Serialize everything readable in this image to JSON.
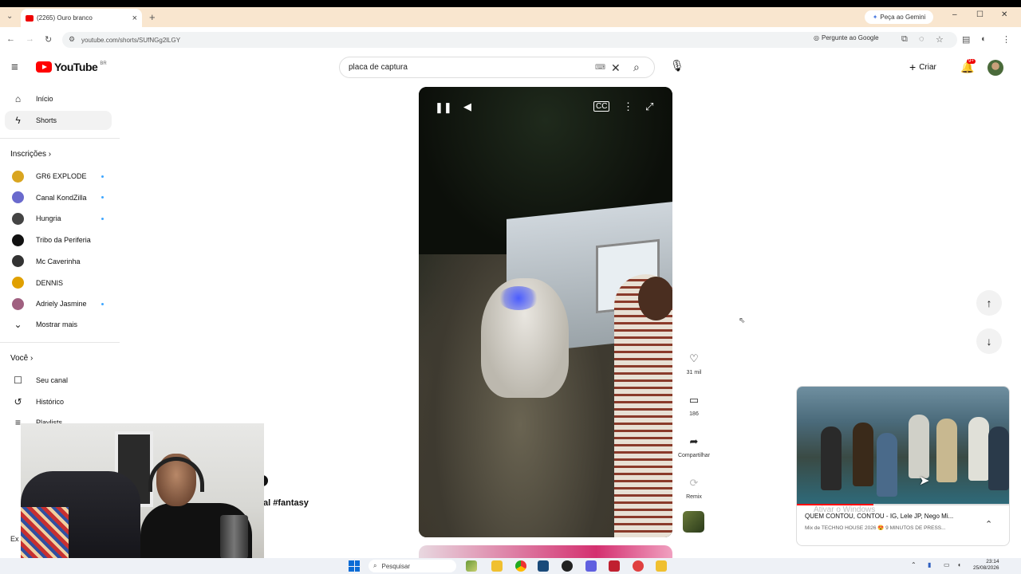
{
  "browser": {
    "tab_title": "(2265) Ouro branco",
    "new_tab": "+",
    "gemini_label": "Peça ao Gemini",
    "url": "youtube.com/shorts/SUfNGg2lLGY",
    "ask_google": "Pergunte ao Google"
  },
  "header": {
    "logo_text": "YouTube",
    "logo_region": "BR",
    "search_value": "placa de captura",
    "create_label": "Criar",
    "notification_count": "9+"
  },
  "sidebar": {
    "main": [
      {
        "label": "Início",
        "icon": "home-icon",
        "glyph": "⌂"
      },
      {
        "label": "Shorts",
        "icon": "shorts-icon",
        "glyph": "ϟ"
      }
    ],
    "subscriptions_title": "Inscrições",
    "subscriptions": [
      {
        "label": "GR6 EXPLODE",
        "color": "#d9a520",
        "new": true
      },
      {
        "label": "Canal KondZilla",
        "color": "#6a6acd",
        "new": true
      },
      {
        "label": "Hungria",
        "color": "#444444",
        "new": true
      },
      {
        "label": "Tribo da Periferia",
        "color": "#111111",
        "new": false
      },
      {
        "label": "Mc Caverinha",
        "color": "#333333",
        "new": false
      },
      {
        "label": "DENNIS",
        "color": "#e0a000",
        "new": false
      },
      {
        "label": "Adriely Jasmine",
        "color": "#a06080",
        "new": true
      }
    ],
    "show_more": "Mostrar mais",
    "you_title": "Você",
    "you_items": [
      {
        "label": "Seu canal",
        "glyph": "☐"
      },
      {
        "label": "Histórico",
        "glyph": "↺"
      },
      {
        "label": "Playlists",
        "glyph": "≡"
      }
    ],
    "explore_partial": "Ex"
  },
  "video": {
    "caption_partial": "al #fantasy"
  },
  "actions": {
    "likes": "31 mil",
    "comments": "186",
    "share": "Compartilhar",
    "remix": "Remix"
  },
  "miniplayer": {
    "title": "QUEM CONTOU, CONTOU - IG, Lele JP, Nego Mi...",
    "subtitle": "Mix de TECHNO HOUSE 2026 😍 9 MINUTOS DE PRESS...",
    "progress": 0.36
  },
  "windows_watermark": "Ativar o Windows",
  "taskbar": {
    "search_placeholder": "Pesquisar",
    "time": "23:14",
    "date": "25/08/2026"
  },
  "colors": {
    "youtube_red": "#ff0000",
    "tabstrip": "#f9e6cf",
    "taskbar": "#eef1f6"
  }
}
